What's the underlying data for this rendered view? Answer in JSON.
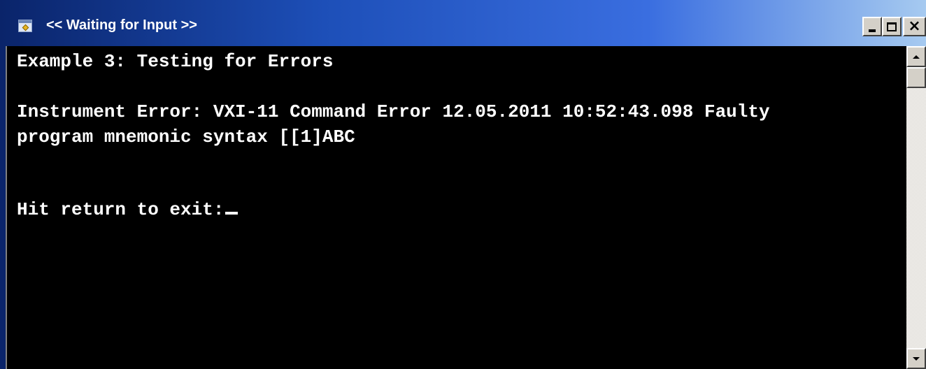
{
  "window": {
    "title": "<< Waiting for Input >>",
    "app_icon": "console-app-icon",
    "controls": {
      "minimize_icon": "minimize-icon",
      "maximize_icon": "maximize-icon",
      "close_icon": "close-icon",
      "close_glyph": "×"
    }
  },
  "console": {
    "lines": [
      "Example 3: Testing for Errors",
      "Instrument Error: VXI-11 Command Error 12.05.2011 10:52:43.098 Faulty",
      "program mnemonic syntax [[1]ABC",
      "Hit return to exit:"
    ],
    "colors": {
      "background": "#000000",
      "text": "#ffffff"
    }
  },
  "scrollbar": {
    "up_icon": "scroll-up-arrow-icon",
    "down_icon": "scroll-down-arrow-icon"
  }
}
